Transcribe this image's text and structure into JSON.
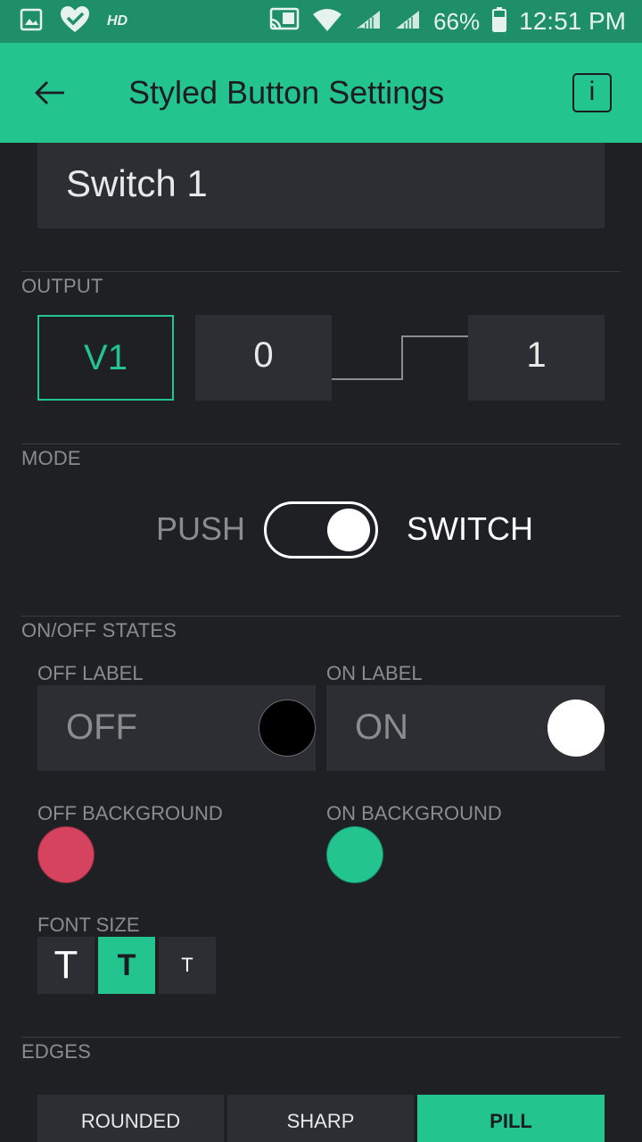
{
  "status_bar": {
    "battery_text": "66%",
    "time": "12:51 PM",
    "hd_label": "HD",
    "icons": [
      "image-icon",
      "heart-check-icon",
      "cast-icon",
      "wifi-icon",
      "signal-icon",
      "signal-icon",
      "battery-icon"
    ]
  },
  "app_bar": {
    "title": "Styled Button Settings",
    "info_label": "i",
    "back_icon": "arrow-left-icon"
  },
  "widget_name": "Switch 1",
  "output": {
    "section_title": "OUTPUT",
    "pin": "V1",
    "low_value": "0",
    "high_value": "1"
  },
  "mode": {
    "section_title": "MODE",
    "left_label": "PUSH",
    "right_label": "SWITCH",
    "selected": "SWITCH"
  },
  "states": {
    "section_title": "ON/OFF STATES",
    "off_label_title": "OFF LABEL",
    "off_label_value": "OFF",
    "off_label_color": "#000000",
    "on_label_title": "ON LABEL",
    "on_label_value": "ON",
    "on_label_color": "#ffffff",
    "off_background_title": "OFF BACKGROUND",
    "off_background_color": "#d5435e",
    "on_background_title": "ON BACKGROUND",
    "on_background_color": "#23c48e"
  },
  "font_size": {
    "title": "FONT SIZE",
    "options": [
      "T",
      "T",
      "T"
    ],
    "selected_index": 1
  },
  "edges": {
    "section_title": "EDGES",
    "options": [
      "ROUNDED",
      "SHARP",
      "PILL"
    ],
    "selected": "PILL"
  },
  "colors": {
    "accent": "#23c48e",
    "status_bar": "#1f8f6a",
    "background": "#1f2024",
    "field": "#2d2e33"
  }
}
